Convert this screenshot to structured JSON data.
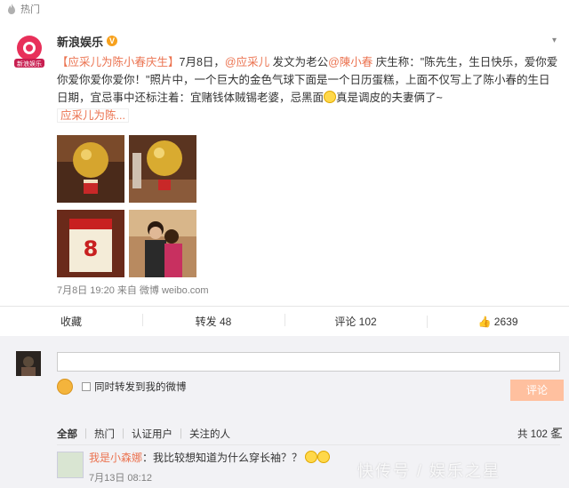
{
  "topbar": {
    "label": "热门"
  },
  "post": {
    "username": "新浪娱乐",
    "verified_badge": "V",
    "text_parts": {
      "tag": "【应采儿为陈小春庆生】",
      "p1": "7月8日，",
      "mention1": "@应采儿",
      "p2": " 发文为老公",
      "mention2": "@陳小春",
      "p3": " 庆生称：\"陈先生，生日快乐，爱你爱你爱你爱你爱你！\"照片中，一个巨大的金色气球下面是一个日历蛋糕，上面不仅写上了陈小春的生日日期，宜忌事中还标注着：宜赌钱体贼锡老婆，忌黑面",
      "p4": "真是调皮的夫妻俩了~"
    },
    "topic_tag": "应采儿为陈...",
    "meta": "7月8日 19:20 来自 微博 weibo.com",
    "actions": {
      "favorite": "收藏",
      "repost": "转发 48",
      "comment": "评论 102",
      "like": "2639"
    }
  },
  "compose": {
    "checkbox_label": "同时转发到我的微博",
    "submit": "评论"
  },
  "comments": {
    "filters": [
      "全部",
      "热门",
      "认证用户",
      "关注的人"
    ],
    "count": "共 102 条",
    "items": [
      {
        "user": "我是小森娜",
        "text": "：我比较想知道为什么穿长袖？？",
        "time": "7月13日 08:12"
      }
    ]
  },
  "watermark": "快传号 / 娱乐之星"
}
